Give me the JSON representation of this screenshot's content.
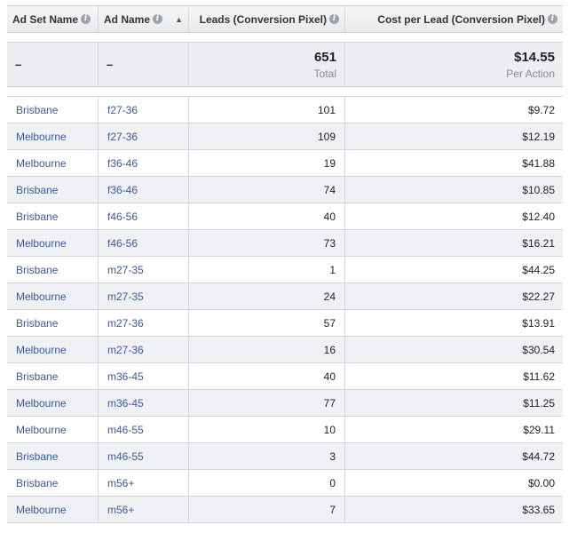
{
  "headers": {
    "ad_set_name": "Ad Set Name",
    "ad_name": "Ad Name",
    "leads": "Leads (Conversion Pixel)",
    "cost_per_lead": "Cost per Lead (Conversion Pixel)",
    "info_icon": "i",
    "sort_icon": "▲"
  },
  "totals": {
    "ad_set_name": "–",
    "ad_name": "–",
    "leads": "651",
    "leads_caption": "Total",
    "cost_per_lead": "$14.55",
    "cost_caption": "Per Action"
  },
  "rows": [
    {
      "ad_set": "Brisbane",
      "ad": "f27-36",
      "leads": "101",
      "cost": "$9.72"
    },
    {
      "ad_set": "Melbourne",
      "ad": "f27-36",
      "leads": "109",
      "cost": "$12.19"
    },
    {
      "ad_set": "Melbourne",
      "ad": "f36-46",
      "leads": "19",
      "cost": "$41.88"
    },
    {
      "ad_set": "Brisbane",
      "ad": "f36-46",
      "leads": "74",
      "cost": "$10.85"
    },
    {
      "ad_set": "Brisbane",
      "ad": "f46-56",
      "leads": "40",
      "cost": "$12.40"
    },
    {
      "ad_set": "Melbourne",
      "ad": "f46-56",
      "leads": "73",
      "cost": "$16.21"
    },
    {
      "ad_set": "Brisbane",
      "ad": "m27-35",
      "leads": "1",
      "cost": "$44.25"
    },
    {
      "ad_set": "Melbourne",
      "ad": "m27-35",
      "leads": "24",
      "cost": "$22.27"
    },
    {
      "ad_set": "Brisbane",
      "ad": "m27-36",
      "leads": "57",
      "cost": "$13.91"
    },
    {
      "ad_set": "Melbourne",
      "ad": "m27-36",
      "leads": "16",
      "cost": "$30.54"
    },
    {
      "ad_set": "Brisbane",
      "ad": "m36-45",
      "leads": "40",
      "cost": "$11.62"
    },
    {
      "ad_set": "Melbourne",
      "ad": "m36-45",
      "leads": "77",
      "cost": "$11.25"
    },
    {
      "ad_set": "Melbourne",
      "ad": "m46-55",
      "leads": "10",
      "cost": "$29.11"
    },
    {
      "ad_set": "Brisbane",
      "ad": "m46-55",
      "leads": "3",
      "cost": "$44.72"
    },
    {
      "ad_set": "Brisbane",
      "ad": "m56+",
      "leads": "0",
      "cost": "$0.00"
    },
    {
      "ad_set": "Melbourne",
      "ad": "m56+",
      "leads": "7",
      "cost": "$33.65"
    }
  ]
}
